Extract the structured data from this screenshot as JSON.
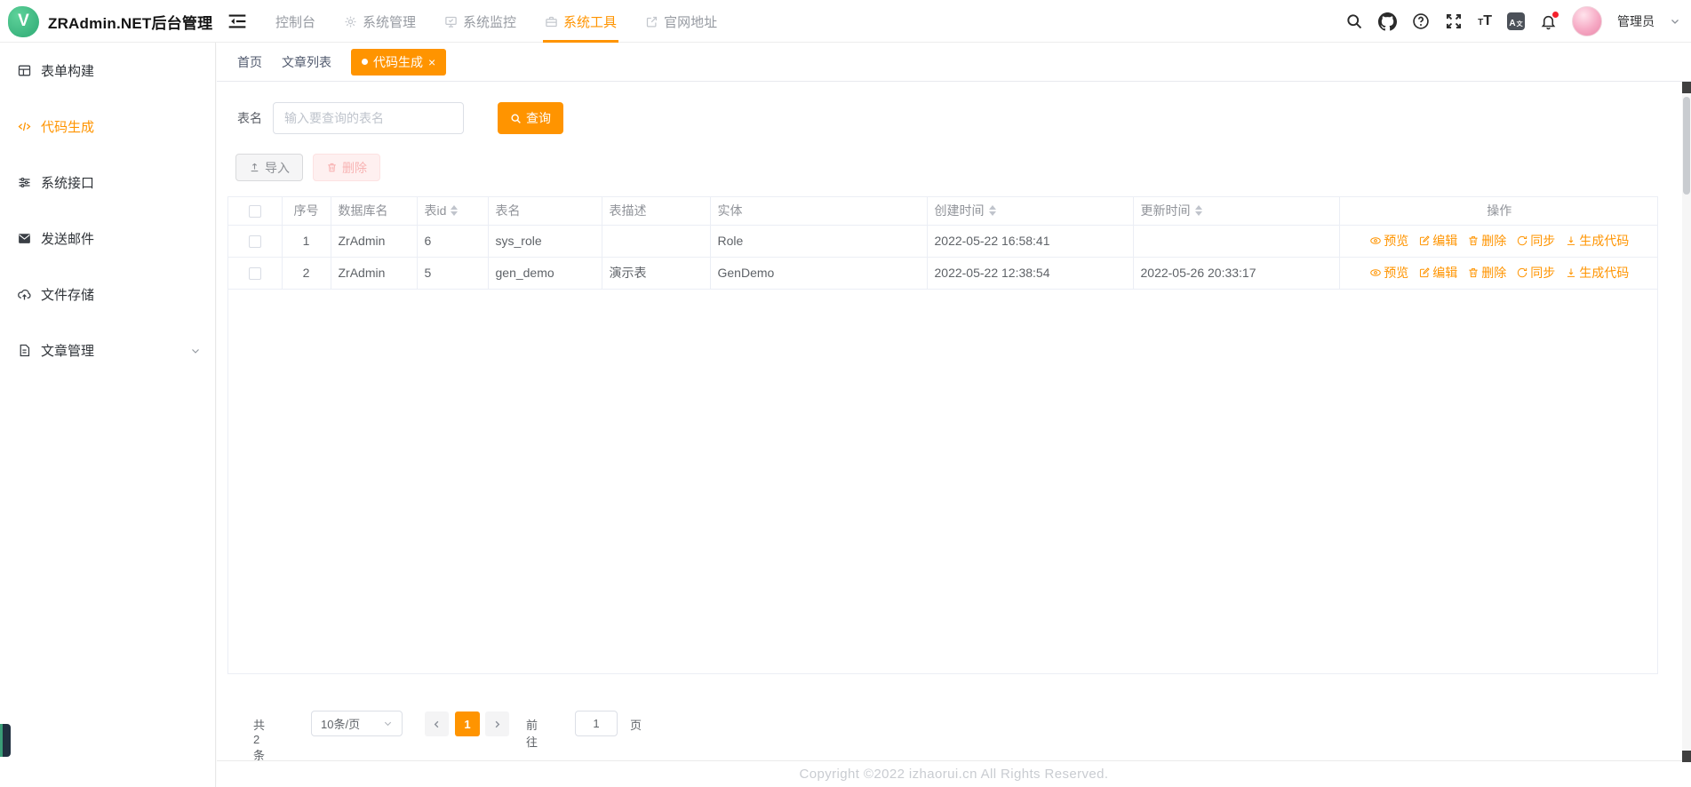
{
  "colors": {
    "accent": "#ff9400",
    "danger_soft": "#fef0f0",
    "sidebar_active": "#ff9400"
  },
  "app": {
    "logo_letter": "V",
    "title": "ZRAdmin.NET后台管理"
  },
  "topnav": {
    "items": [
      {
        "label": "控制台"
      },
      {
        "label": "系统管理",
        "icon": "gear-icon"
      },
      {
        "label": "系统监控",
        "icon": "monitor-icon"
      },
      {
        "label": "系统工具",
        "icon": "briefcase-icon",
        "active": true
      },
      {
        "label": "官网地址",
        "icon": "external-link-icon"
      }
    ]
  },
  "userbar": {
    "username": "管理员"
  },
  "sidebar": {
    "items": [
      {
        "label": "表单构建",
        "icon": "grid-icon"
      },
      {
        "label": "代码生成",
        "icon": "code-icon",
        "active": true
      },
      {
        "label": "系统接口",
        "icon": "sliders-icon"
      },
      {
        "label": "发送邮件",
        "icon": "mail-icon"
      },
      {
        "label": "文件存储",
        "icon": "cloud-upload-icon"
      },
      {
        "label": "文章管理",
        "icon": "document-icon",
        "expandable": true
      }
    ]
  },
  "tabs": {
    "items": [
      {
        "label": "首页"
      },
      {
        "label": "文章列表"
      },
      {
        "label": "代码生成",
        "active": true,
        "closable": true
      }
    ],
    "close_glyph": "×"
  },
  "search": {
    "label": "表名",
    "placeholder": "输入要查询的表名",
    "query_button": "查询"
  },
  "toolbar": {
    "import_label": "导入",
    "delete_label": "删除"
  },
  "table": {
    "columns": [
      {
        "label": "序号"
      },
      {
        "label": "数据库名"
      },
      {
        "label": "表id",
        "sortable": true
      },
      {
        "label": "表名"
      },
      {
        "label": "表描述"
      },
      {
        "label": "实体"
      },
      {
        "label": "创建时间",
        "sortable": true
      },
      {
        "label": "更新时间",
        "sortable": true
      },
      {
        "label": "操作"
      }
    ],
    "rows": [
      {
        "cells": [
          "1",
          "ZrAdmin",
          "6",
          "sys_role",
          "",
          "Role",
          "2022-05-22 16:58:41",
          ""
        ]
      },
      {
        "cells": [
          "2",
          "ZrAdmin",
          "5",
          "gen_demo",
          "演示表",
          "GenDemo",
          "2022-05-22 12:38:54",
          "2022-05-26 20:33:17"
        ]
      }
    ],
    "action_labels": [
      "预览",
      "编辑",
      "删除",
      "同步",
      "生成代码"
    ]
  },
  "pagination": {
    "total": "共 2 条",
    "page_size": "10条/页",
    "current_page": "1",
    "goto_label": "前往",
    "goto_value": "1",
    "unit_label": "页"
  },
  "footer": {
    "copyright": "Copyright ©2022 izhaorui.cn All Rights Reserved."
  }
}
